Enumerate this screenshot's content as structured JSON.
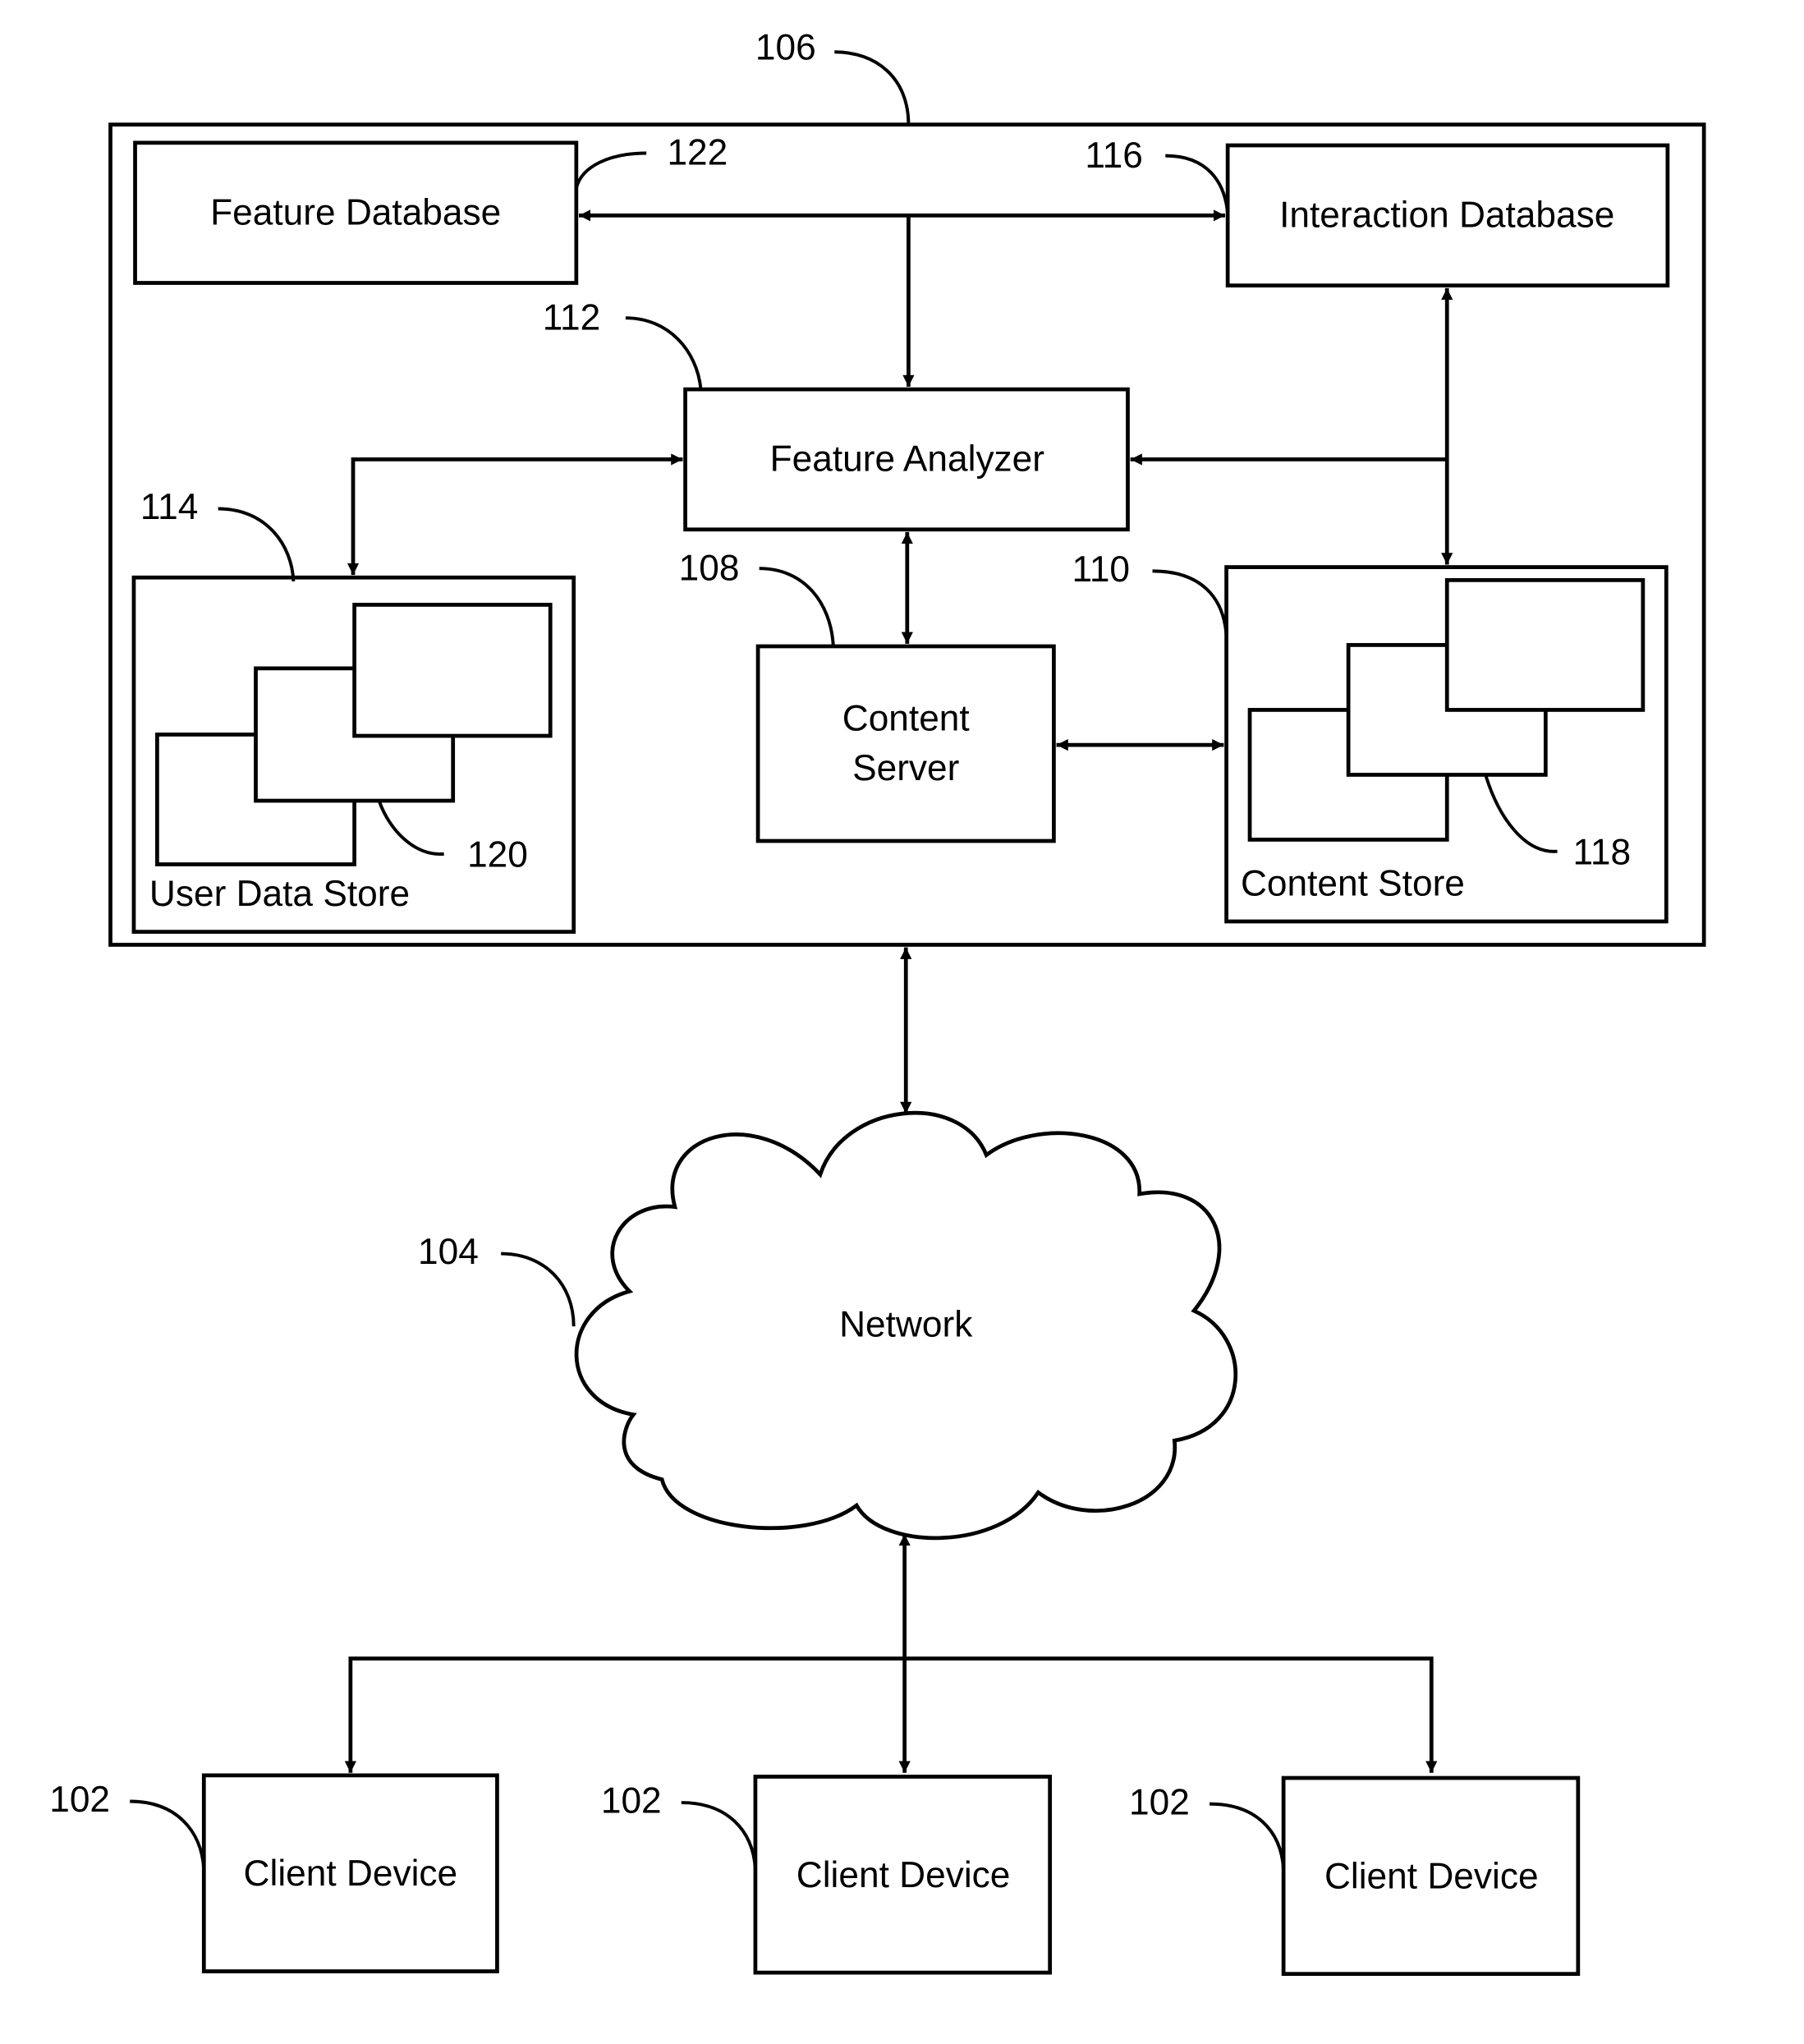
{
  "diagram": {
    "system_ref": "106",
    "network": {
      "label": "Network",
      "ref": "104"
    },
    "components": {
      "feature_database": {
        "label": "Feature Database",
        "ref": "122"
      },
      "interaction_database": {
        "label": "Interaction Database",
        "ref": "116"
      },
      "feature_analyzer": {
        "label": "Feature Analyzer",
        "ref": "112"
      },
      "user_data_store": {
        "label": "User Data Store",
        "ref": "114",
        "item_ref": "120"
      },
      "content_server": {
        "label_line1": "Content",
        "label_line2": "Server",
        "ref": "108"
      },
      "content_store": {
        "label": "Content Store",
        "ref": "110",
        "item_ref": "118"
      }
    },
    "clients": [
      {
        "label": "Client Device",
        "ref": "102"
      },
      {
        "label": "Client Device",
        "ref": "102"
      },
      {
        "label": "Client Device",
        "ref": "102"
      }
    ]
  }
}
